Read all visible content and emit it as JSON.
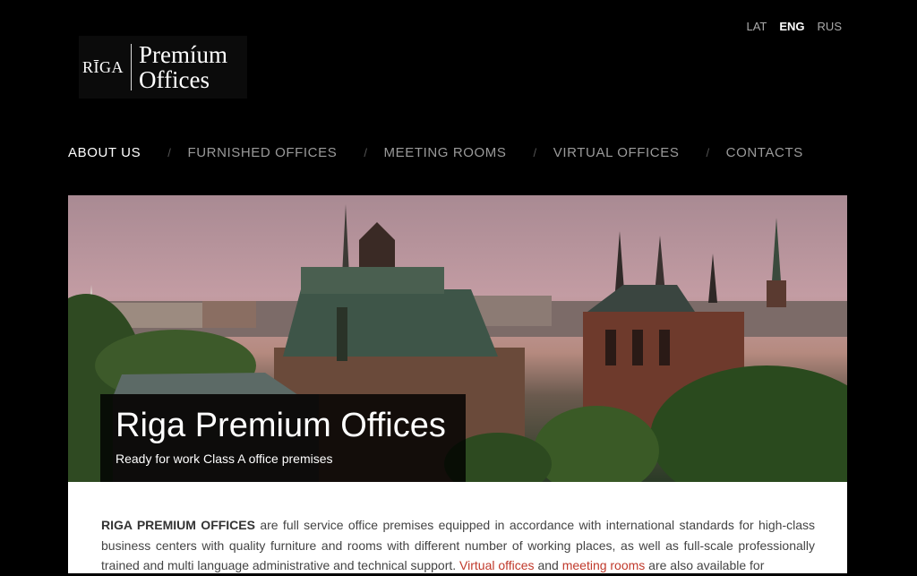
{
  "logo": {
    "riga": "RĪGA",
    "line1": "Premíum",
    "line2": "Offices"
  },
  "languages": [
    {
      "label": "LAT",
      "active": false
    },
    {
      "label": "ENG",
      "active": true
    },
    {
      "label": "RUS",
      "active": false
    }
  ],
  "nav": {
    "items": [
      {
        "label": "ABOUT US",
        "active": true
      },
      {
        "label": "FURNISHED OFFICES",
        "active": false
      },
      {
        "label": "MEETING ROOMS",
        "active": false
      },
      {
        "label": "VIRTUAL OFFICES",
        "active": false
      },
      {
        "label": "CONTACTS",
        "active": false
      }
    ],
    "separator": "/"
  },
  "hero": {
    "title": "Riga Premium Offices",
    "subtitle": "Ready for work Class A office premises"
  },
  "intro": {
    "bold": "RIGA PREMIUM OFFICES",
    "text1": " are full service office premises equipped in accordance with international standards for high-class business centers with quality furniture and rooms with different number of working places, as well as full-scale professionally trained and multi language administrative and technical support. ",
    "link1": "Virtual offices",
    "text2": " and ",
    "link2": "meeting rooms",
    "text3": " are also available for"
  },
  "colors": {
    "link": "#c0392b",
    "background": "#000000"
  }
}
